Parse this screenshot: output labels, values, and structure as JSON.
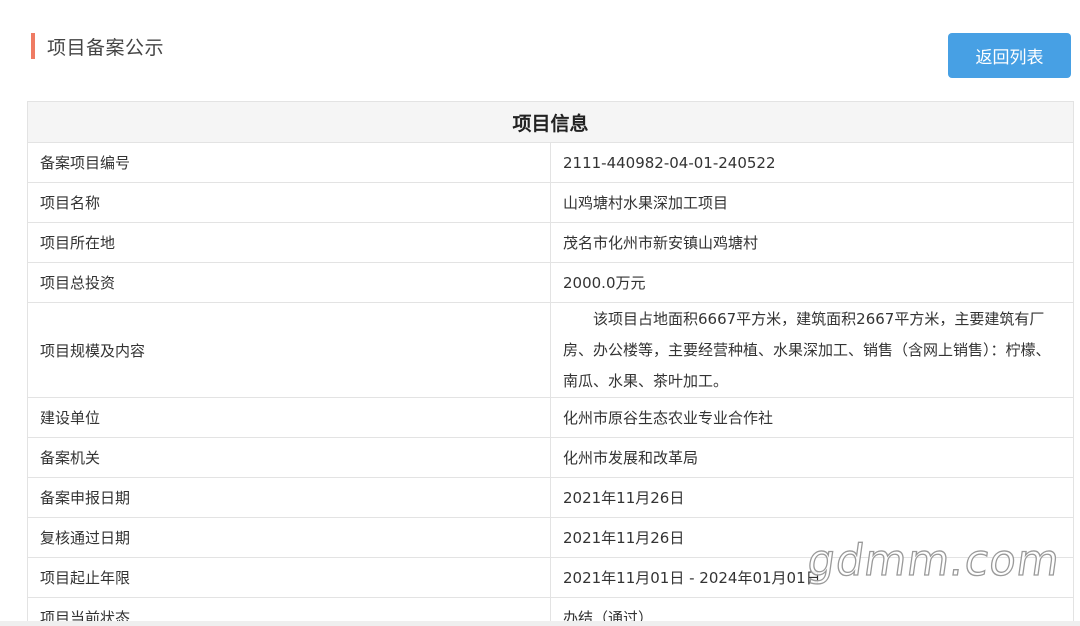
{
  "header": {
    "title": "项目备案公示",
    "accent_color": "#ef7b63",
    "back_button_label": "返回列表",
    "back_button_color": "#47a0e4"
  },
  "table": {
    "caption": "项目信息",
    "rows": [
      {
        "label": "备案项目编号",
        "value": "2111-440982-04-01-240522"
      },
      {
        "label": "项目名称",
        "value": "山鸡塘村水果深加工项目"
      },
      {
        "label": "项目所在地",
        "value": "茂名市化州市新安镇山鸡塘村"
      },
      {
        "label": "项目总投资",
        "value": "2000.0万元"
      },
      {
        "label": "项目规模及内容",
        "value": "该项目占地面积6667平方米，建筑面积2667平方米，主要建筑有厂房、办公楼等，主要经营种植、水果深加工、销售（含网上销售）：柠檬、南瓜、水果、茶叶加工。"
      },
      {
        "label": "建设单位",
        "value": "化州市原谷生态农业专业合作社"
      },
      {
        "label": "备案机关",
        "value": "化州市发展和改革局"
      },
      {
        "label": "备案申报日期",
        "value": "2021年11月26日"
      },
      {
        "label": "复核通过日期",
        "value": "2021年11月26日"
      },
      {
        "label": "项目起止年限",
        "value": "2021年11月01日 - 2024年01月01日"
      },
      {
        "label": "项目当前状态",
        "value": "办结（通过）"
      }
    ]
  },
  "watermark": "gdmm.com"
}
